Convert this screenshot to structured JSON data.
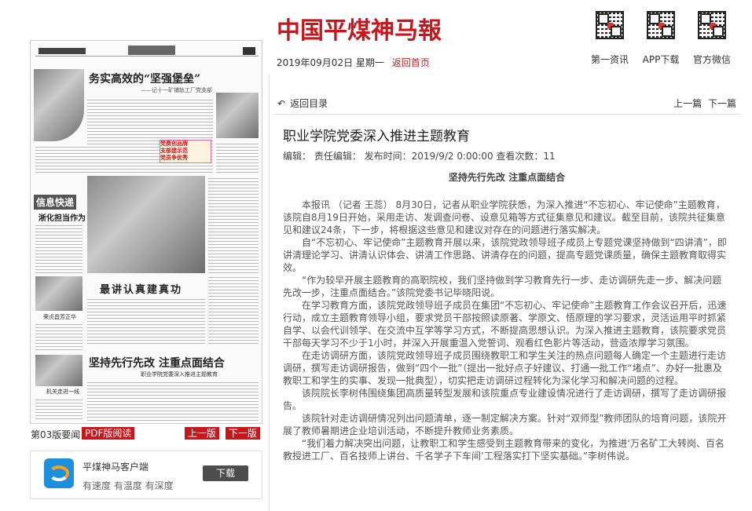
{
  "header": {
    "logo_text": "中国平煤神马報",
    "date": "2019年09月02日",
    "weekday": "星期一",
    "back_home": "返回首页",
    "qr": [
      {
        "label": "第一资讯"
      },
      {
        "label": "APP下载"
      },
      {
        "label": "官方微信"
      }
    ]
  },
  "thumbnail": {
    "headline_1": "务实高效的“坚强堡垒”",
    "subhead_1": "——记十一矿铺轨工厂党支部",
    "side_tag": "信息快递",
    "side_headline": "淅化担当作为",
    "headline_2": "最讲认真建真功",
    "side_caption": "荣贞昌芳正华",
    "headline_3": "坚持先行先改 注重点面结合",
    "subhead_3": "职业学院党委深入推进主题教育",
    "side_caption_2": "机关走进一线",
    "ad_lines": [
      "党费创品牌",
      "支部建示范",
      "党员争优秀"
    ]
  },
  "page_nav": {
    "page_info": "第03版要闻",
    "pdf": "PDF版阅读",
    "prev": "上一版",
    "next": "下一版"
  },
  "app": {
    "title": "平煤神马客户端",
    "slogan": "有速度 有温度 有深度",
    "download": "下载"
  },
  "article": {
    "back_dir": "返回目录",
    "prev": "上一篇",
    "next": "下一篇",
    "title": "职业学院党委深入推进主题教育",
    "meta": "编辑：  责任编辑：  发布时间：2019/9/2 0:00:00 查看次数：11",
    "subtitle": "坚持先行先改 注重点面结合",
    "paragraphs": [
      "本报讯 （记者 王蕊） 8月30日，记者从职业学院获悉，为深入推进“不忘初心、牢记使命”主题教育，该院自8月19日开始，采用走访、发调查问卷、设意见箱等方式征集意见和建议。截至目前，该院共征集意见和建议24条，下一步，将根据这些意见和建议对存在的问题进行落实解决。",
      "自“不忘初心、牢记使命”主题教育开展以来，该院党政领导班子成员上专题党课坚持做到“四讲清”，即讲清理论学习、讲清认识体会、讲清工作思路、讲清存在的问题，提高专题党课质量，确保主题教育取得实效。",
      "“作为较早开展主题教育的高职院校，我们坚持做到学习教育先行一步、走访调研先走一步、解决问题先改一步，注重点面结合。”该院党委书记毕晓阳说。",
      "在学习教育方面，该院党政领导班子成员在集团“不忘初心、牢记使命”主题教育工作会议召开后，迅速行动，成立主题教育领导小组，要求党员干部按照读原著、学原文、悟原理的学习要求，灵活运用平时抓紧自学、以会代训领学、在交流中互学等学习方式，不断提高思想认识。为深入推进主题教育，该院要求党员干部每天学习不少于1小时，并深入开展重温入党誓词、观看红色影片等活动，营造浓厚学习氛围。",
      "在走访调研方面，该院党政领导班子成员围绕教职工和学生关注的热点问题每人确定一个主题进行走访调研，撰写走访调研报告，做到“四个一批”（提出一批好点子好建议、打通一批工作“堵点”、办好一批惠及教职工和学生的实事、发现一批典型），切实把走访调研过程转化为深化学习和解决问题的过程。",
      "该院院长李树伟围绕集团高质量转型发展和该院重点专业建设情况进行了走访调研，撰写了走访调研报告。",
      "该院针对走访调研情况列出问题清单，逐一制定解决方案。针对“双师型”教师团队的培育问题，该院开展了教师暑期进企业培训活动，不断提升教师业务素质。",
      "“我们着力解决突出问题，让教职工和学生感受到主题教育带来的变化，为推进‘万名矿工大转岗、百名教授进工厂、百名技师上讲台、千名学子下车间’工程落实打下坚实基础。”李树伟说。"
    ]
  }
}
